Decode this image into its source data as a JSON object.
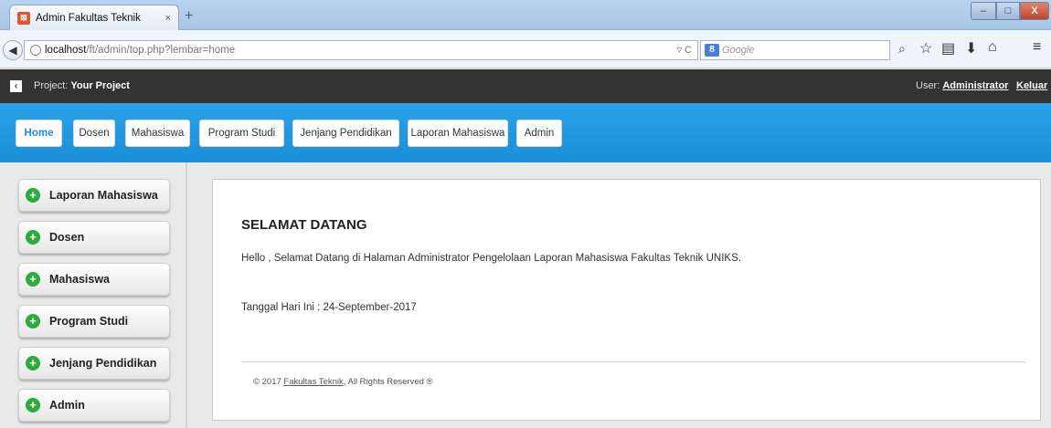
{
  "browser": {
    "tab_title": "Admin Fakultas Teknik",
    "tab_close": "×",
    "new_tab": "+",
    "url_host": "localhost",
    "url_path": "/ft/admin/top.php?lembar=home",
    "url_right": "▿ C",
    "search_engine_glyph": "8",
    "search_placeholder": "Google",
    "favicon_glyph": "⊠",
    "window_controls": {
      "minimize": "–",
      "maximize": "□",
      "close": "X"
    }
  },
  "projectbar": {
    "project_prefix": "Project: ",
    "project_name": "Your Project",
    "user_prefix": "User: ",
    "user_name": "Administrator",
    "logout": "Keluar"
  },
  "menu": {
    "items": [
      {
        "label": "Home",
        "active": true
      },
      {
        "label": "Dosen"
      },
      {
        "label": "Mahasiswa"
      },
      {
        "label": "Program Studi"
      },
      {
        "label": "Jenjang Pendidikan"
      },
      {
        "label": "Laporan Mahasiswa"
      },
      {
        "label": "Admin"
      }
    ]
  },
  "sidebar": {
    "items": [
      {
        "label": "Laporan Mahasiswa"
      },
      {
        "label": "Dosen"
      },
      {
        "label": "Mahasiswa"
      },
      {
        "label": "Program Studi"
      },
      {
        "label": "Jenjang Pendidikan"
      },
      {
        "label": "Admin"
      }
    ]
  },
  "content": {
    "title": "SELAMAT DATANG",
    "hello": "Hello , Selamat Datang di Halaman Administrator Pengelolaan Laporan Mahasiswa Fakultas Teknik UNIKS.",
    "date_text": "Tanggal Hari Ini :  24-September-2017",
    "footer_prefix": "© 2017 ",
    "footer_link": "Fakultas Teknik",
    "footer_suffix": ", All Rights Reserved ®"
  },
  "colors": {
    "menubar": "#1e94dd",
    "projectbar": "#333333",
    "plus_icon": "#2eac3b"
  }
}
